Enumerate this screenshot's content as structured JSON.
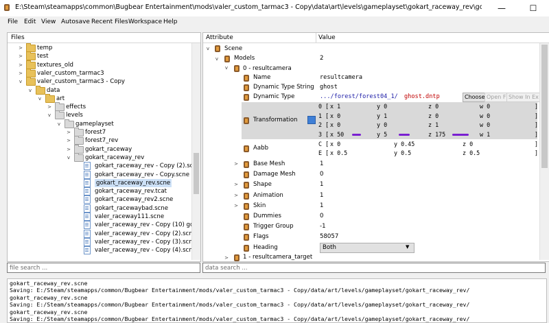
{
  "window": {
    "title": "E:\\Steam\\steamapps\\common\\Bugbear Entertainment\\mods\\valer_custom_tarmac3 - Copy\\data\\art\\levels\\gameplayset\\gokart_raceway_rev\\gokart_raceway_rev.scne - Wreckfest - Ba",
    "minimize": "—",
    "maximize": "☐"
  },
  "menu": [
    "File",
    "Edit",
    "View",
    "Autosave",
    "Recent Files",
    "Workspace",
    "Help"
  ],
  "files": {
    "header": "Files",
    "search_placeholder": "file search ...",
    "items": [
      {
        "label": "temp",
        "type": "folder",
        "level": 2,
        "twisty": ">"
      },
      {
        "label": "test",
        "type": "folder",
        "level": 2,
        "twisty": ">"
      },
      {
        "label": "textures_old",
        "type": "folder",
        "level": 2,
        "twisty": ">"
      },
      {
        "label": "valer_custom_tarmac3",
        "type": "folder",
        "level": 2,
        "twisty": ">"
      },
      {
        "label": "valer_custom_tarmac3 - Copy",
        "type": "folder",
        "level": 2,
        "twisty": "v"
      },
      {
        "label": "data",
        "type": "folder",
        "level": 3,
        "twisty": "v"
      },
      {
        "label": "art",
        "type": "folder",
        "level": 4,
        "twisty": "v"
      },
      {
        "label": "effects",
        "type": "folder-gray",
        "level": 5,
        "twisty": ">"
      },
      {
        "label": "levels",
        "type": "folder-gray",
        "level": 5,
        "twisty": "v"
      },
      {
        "label": "gameplayset",
        "type": "folder-gray",
        "level": 6,
        "twisty": "v"
      },
      {
        "label": "forest7",
        "type": "folder-gray",
        "level": 7,
        "twisty": ">"
      },
      {
        "label": "forest7_rev",
        "type": "folder-gray",
        "level": 7,
        "twisty": ">"
      },
      {
        "label": "gokart_raceway",
        "type": "folder-gray",
        "level": 7,
        "twisty": ">"
      },
      {
        "label": "gokart_raceway_rev",
        "type": "folder-gray",
        "level": 7,
        "twisty": "v"
      },
      {
        "label": "gokart_raceway_rev - Copy (2).scne",
        "type": "file",
        "level": 8,
        "twisty": ""
      },
      {
        "label": "gokart_raceway_rev - Copy.scne",
        "type": "file",
        "level": 8,
        "twisty": ""
      },
      {
        "label": "gokart_raceway_rev.scne",
        "type": "file",
        "level": 8,
        "twisty": "",
        "selected": true
      },
      {
        "label": "gokart_raceway_rev.tcat",
        "type": "file",
        "level": 8,
        "twisty": ""
      },
      {
        "label": "gokart_raceway_rev2.scne",
        "type": "file",
        "level": 8,
        "twisty": ""
      },
      {
        "label": "gokart_racewaybad.scne",
        "type": "file",
        "level": 8,
        "twisty": ""
      },
      {
        "label": "valer_raceway111.scne",
        "type": "file",
        "level": 8,
        "twisty": ""
      },
      {
        "label": "valer_raceway_rev - Copy (10) goo...",
        "type": "file",
        "level": 8,
        "twisty": ""
      },
      {
        "label": "valer_raceway_rev - Copy (2).scne",
        "type": "file",
        "level": 8,
        "twisty": ""
      },
      {
        "label": "valer_raceway_rev - Copy (3).scne",
        "type": "file",
        "level": 8,
        "twisty": ""
      },
      {
        "label": "valer_raceway_rev - Copy (4).scne",
        "type": "file",
        "level": 8,
        "twisty": ""
      }
    ]
  },
  "props": {
    "header_attribute": "Attribute",
    "header_value": "Value",
    "search_placeholder": "data search ...",
    "scene": "Scene",
    "models_label": "Models",
    "models_value": "2",
    "model0": "0 - resultcamera",
    "name_label": "Name",
    "name_value": "resultcamera",
    "dts_label": "Dynamic Type String",
    "dts_value": "ghost",
    "dt_label": "Dynamic Type",
    "dt_path": ".../forest/forest04_1/",
    "dt_file": "ghost.dntp",
    "dt_btn_choose": "Choose",
    "dt_btn_open": "Open F",
    "dt_btn_show": "Show In Ex",
    "transformation_label": "Transformation",
    "matrix": [
      [
        "0",
        "[",
        "x 1",
        "y 0",
        "z 0",
        "w 0",
        "]"
      ],
      [
        "1",
        "[",
        "x 0",
        "y 1",
        "z 0",
        "w 0",
        "]"
      ],
      [
        "2",
        "[",
        "x 0",
        "y 0",
        "z 1",
        "w 0",
        "]"
      ],
      [
        "3",
        "[",
        "x 50",
        "y 5",
        "z 175",
        "w 1",
        "]"
      ]
    ],
    "aabb_label": "Aabb",
    "aabb": [
      [
        "C",
        "[",
        "x 0",
        "y 0.45",
        "z 0",
        "]"
      ],
      [
        "E",
        "[",
        "x 0.5",
        "y 0.5",
        "z 0.5",
        "]"
      ]
    ],
    "rows": [
      {
        "label": "Base Mesh",
        "value": "1",
        "twisty": ">"
      },
      {
        "label": "Damage Mesh",
        "value": "0",
        "twisty": ""
      },
      {
        "label": "Shape",
        "value": "1",
        "twisty": ">"
      },
      {
        "label": "Animation",
        "value": "1",
        "twisty": ">"
      },
      {
        "label": "Skin",
        "value": "1",
        "twisty": ">"
      },
      {
        "label": "Dummies",
        "value": "0",
        "twisty": ""
      },
      {
        "label": "Trigger Group",
        "value": "-1",
        "twisty": ""
      },
      {
        "label": "Flags",
        "value": "58057",
        "twisty": ""
      }
    ],
    "heading_label": "Heading",
    "heading_value": "Both",
    "model1": "1 - resultcamera_target"
  },
  "log": [
    "gokart_raceway_rev.scne",
    "Saving: E:/Steam/steamapps/common/Bugbear Entertainment/mods/valer_custom_tarmac3 - Copy/data/art/levels/gameplayset/gokart_raceway_rev/",
    "gokart_raceway_rev.scne",
    "Saving: E:/Steam/steamapps/common/Bugbear Entertainment/mods/valer_custom_tarmac3 - Copy/data/art/levels/gameplayset/gokart_raceway_rev/",
    "gokart_raceway_rev.scne",
    "Saving: E:/Steam/steamapps/common/Bugbear Entertainment/mods/valer_custom_tarmac3 - Copy/data/art/levels/gameplayset/gokart_raceway_rev/",
    "gokart_raceway_rev.scne"
  ],
  "colors": {
    "selection": "#cde1f7",
    "link_red": "#c00000",
    "highlight_purple": "#7a1fd1"
  }
}
